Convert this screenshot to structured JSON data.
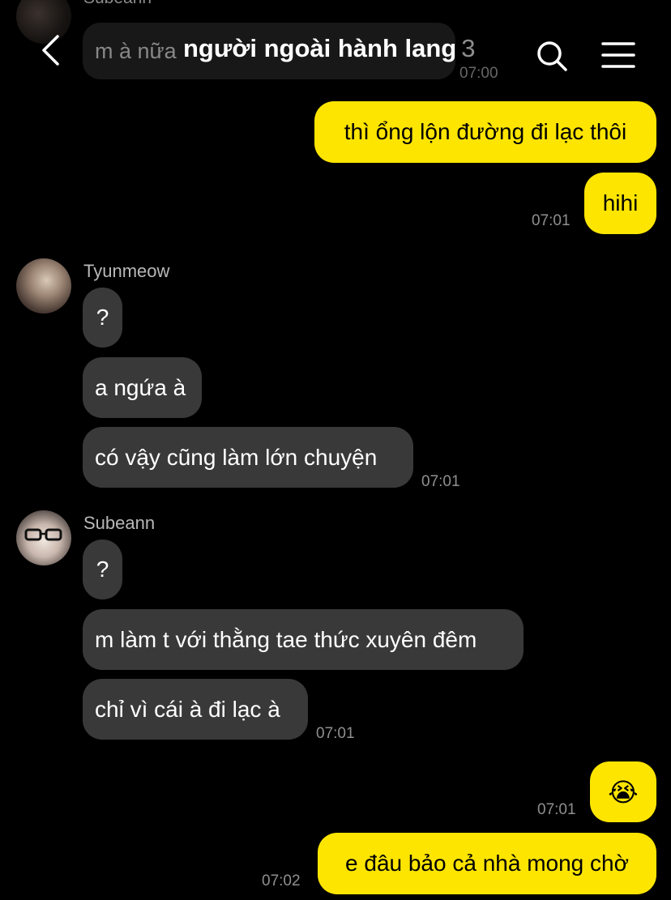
{
  "header": {
    "title": "người ngoài hành lang",
    "member_count": "3"
  },
  "ghost": {
    "sender": "Subeann",
    "text": "m à nữa",
    "time": "07:00"
  },
  "messages": {
    "m1": {
      "text": "thì ổng lộn đường đi lạc thôi"
    },
    "m2": {
      "text": "hihi",
      "time": "07:01"
    },
    "tyun": {
      "sender": "Tyunmeow",
      "msgs": [
        "?",
        "a ngứa à",
        "có vậy cũng làm lớn chuyện"
      ],
      "time": "07:01"
    },
    "sube": {
      "sender": "Subeann",
      "msgs": [
        "?",
        "m làm t với thằng tae thức xuyên đêm",
        "chỉ vì cái à đi lạc à"
      ],
      "time": "07:01"
    },
    "m3": {
      "text": "😭",
      "time": "07:01"
    },
    "m4": {
      "text": "e đâu bảo cả nhà mong chờ",
      "time": "07:02"
    }
  },
  "colors": {
    "my_bubble": "#fee500",
    "other_bubble": "#393939",
    "background": "#000000"
  },
  "icons": {
    "back": "chevron-left-icon",
    "search": "search-icon",
    "menu": "hamburger-menu-icon"
  }
}
